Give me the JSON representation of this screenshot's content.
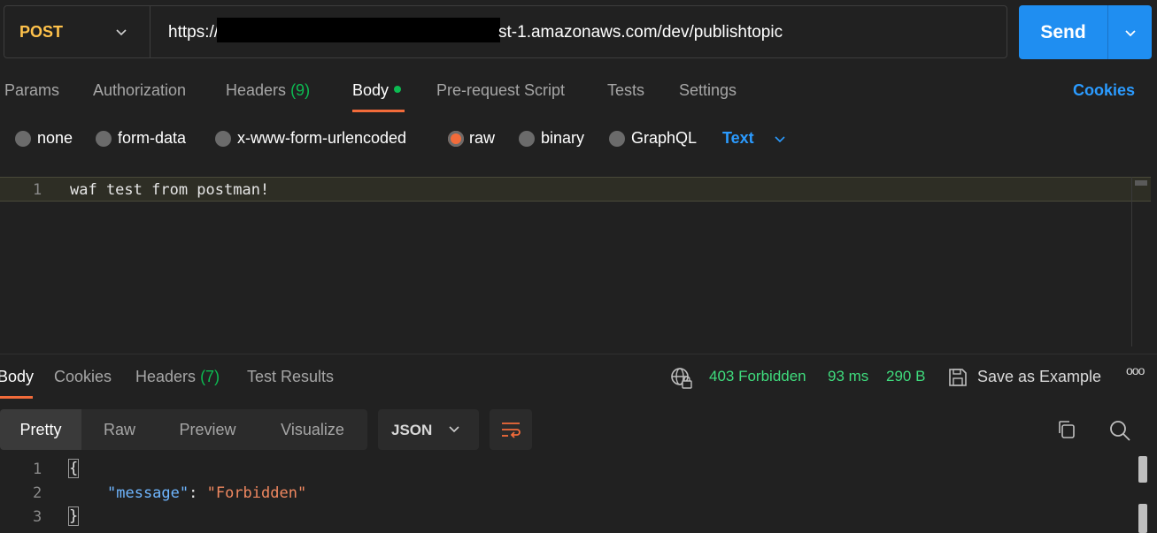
{
  "request": {
    "method": "POST",
    "url_prefix": "https://",
    "url_suffix": "st-1.amazonaws.com/dev/publishtopic",
    "send_label": "Send"
  },
  "request_tabs": {
    "params": "Params",
    "authorization": "Authorization",
    "headers": "Headers",
    "headers_count": "(9)",
    "body": "Body",
    "pre_request": "Pre-request Script",
    "tests": "Tests",
    "settings": "Settings",
    "cookies": "Cookies"
  },
  "body_types": {
    "none": "none",
    "form_data": "form-data",
    "urlencoded": "x-www-form-urlencoded",
    "raw": "raw",
    "binary": "binary",
    "graphql": "GraphQL",
    "selected": "raw",
    "raw_format": "Text"
  },
  "request_body": {
    "line_number": "1",
    "text": "waf test from postman!"
  },
  "response_tabs": {
    "body": "Body",
    "cookies": "Cookies",
    "headers": "Headers",
    "headers_count": "(7)",
    "test_results": "Test Results"
  },
  "response_status": {
    "status": "403 Forbidden",
    "time": "93 ms",
    "size": "290 B",
    "save_example": "Save as Example",
    "more": "ooo"
  },
  "format_toolbar": {
    "pretty": "Pretty",
    "raw": "Raw",
    "preview": "Preview",
    "visualize": "Visualize",
    "format": "JSON"
  },
  "response_body": {
    "ln1": "1",
    "ln2": "2",
    "ln3": "3",
    "open_brace": "{",
    "key": "\"message\"",
    "colon": ": ",
    "value": "\"Forbidden\"",
    "close_brace": "}"
  },
  "colors": {
    "accent_blue": "#1f8ef1",
    "method_yellow": "#ffc24b",
    "active_orange": "#f26b3a",
    "status_green": "#3fdc7d"
  }
}
